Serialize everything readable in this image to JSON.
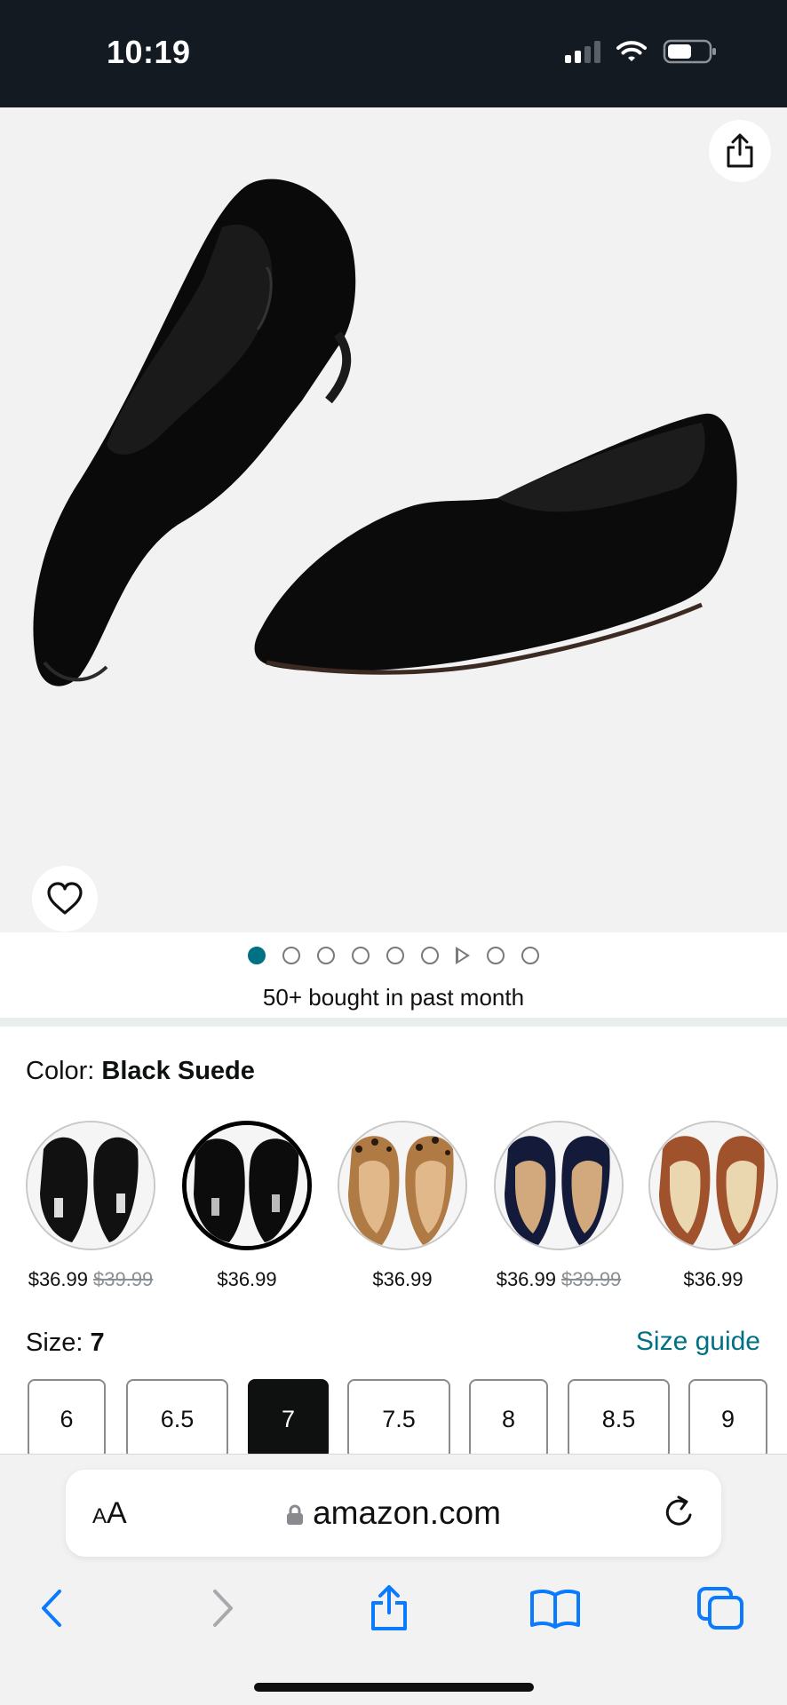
{
  "status_bar": {
    "time": "10:19",
    "battery_level": 0.6
  },
  "product": {
    "share_icon": "share-icon",
    "wishlist_icon": "heart-icon",
    "image_dots": {
      "count": 8,
      "active_index": 0,
      "video_after_index": 5
    },
    "bought_text": "50+ bought in past month"
  },
  "color": {
    "label": "Color:",
    "selected": "Black Suede",
    "options": [
      {
        "name": "Black Leather",
        "price": "$36.99",
        "list_price": "$39.99",
        "selected": false
      },
      {
        "name": "Black Suede",
        "price": "$36.99",
        "list_price": "",
        "selected": true
      },
      {
        "name": "Leopard",
        "price": "$36.99",
        "list_price": "",
        "selected": false
      },
      {
        "name": "Navy",
        "price": "$36.99",
        "list_price": "$39.99",
        "selected": false
      },
      {
        "name": "Brown",
        "price": "$36.99",
        "list_price": "",
        "selected": false
      }
    ]
  },
  "size": {
    "label": "Size:",
    "selected": "7",
    "guide_label": "Size guide",
    "options": [
      "6",
      "6.5",
      "7",
      "7.5",
      "8",
      "8.5",
      "9"
    ]
  },
  "browser": {
    "text_size_label": "AA",
    "domain": "amazon.com",
    "toolbar": [
      "back-icon",
      "forward-icon",
      "share-icon",
      "bookmarks-icon",
      "tabs-icon"
    ]
  },
  "colors": {
    "link": "#007185",
    "status_bg": "#131a22",
    "accent_blue": "#0a7aff"
  }
}
